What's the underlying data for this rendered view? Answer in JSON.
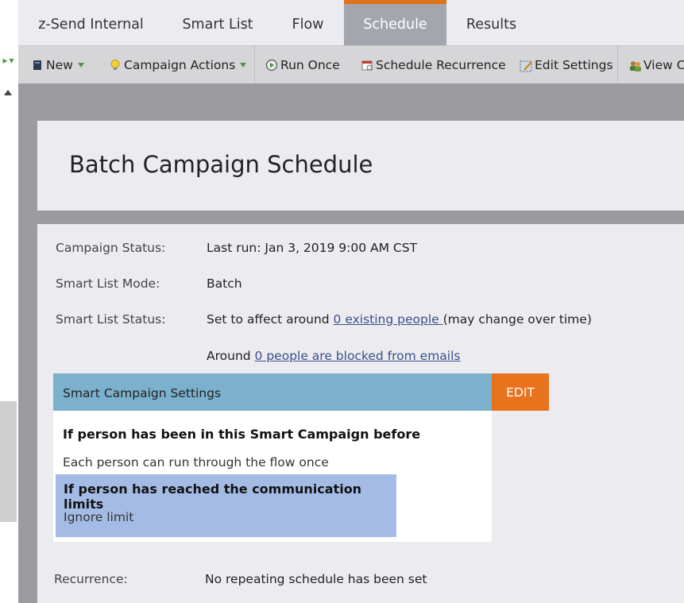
{
  "tabs": [
    {
      "label": "z-Send Internal"
    },
    {
      "label": "Smart List"
    },
    {
      "label": "Flow"
    },
    {
      "label": "Schedule",
      "active": true
    },
    {
      "label": "Results"
    }
  ],
  "toolbar": {
    "new_label": "New",
    "campaign_actions_label": "Campaign Actions",
    "run_once_label": "Run Once",
    "schedule_recurrence_label": "Schedule Recurrence",
    "edit_settings_label": "Edit Settings",
    "view_label": "View C"
  },
  "page": {
    "title": "Batch Campaign Schedule"
  },
  "details": {
    "campaign_status_label": "Campaign Status:",
    "campaign_status_value": "Last run: Jan 3, 2019 9:00 AM CST",
    "smart_list_mode_label": "Smart List Mode:",
    "smart_list_mode_value": "Batch",
    "smart_list_status_label": "Smart List Status:",
    "smart_list_status_prefix": "Set to affect around ",
    "smart_list_status_link": "0 existing people ",
    "smart_list_status_suffix": "(may change over time)",
    "blocked_prefix": "Around ",
    "blocked_link": "0 people are blocked from emails",
    "recurrence_label": "Recurrence:",
    "recurrence_value": "No repeating schedule has been set"
  },
  "settings": {
    "header": "Smart Campaign Settings",
    "edit_label": "EDIT",
    "before_title": "If person has been in this Smart Campaign before",
    "before_value": "Each person can run through the flow once",
    "limits_title": "If person has reached the communication limits",
    "limits_value": "Ignore limit"
  },
  "colors": {
    "accent_orange": "#e8731c",
    "settings_header": "#7bb1cd",
    "limits_highlight": "#a4bce5"
  }
}
